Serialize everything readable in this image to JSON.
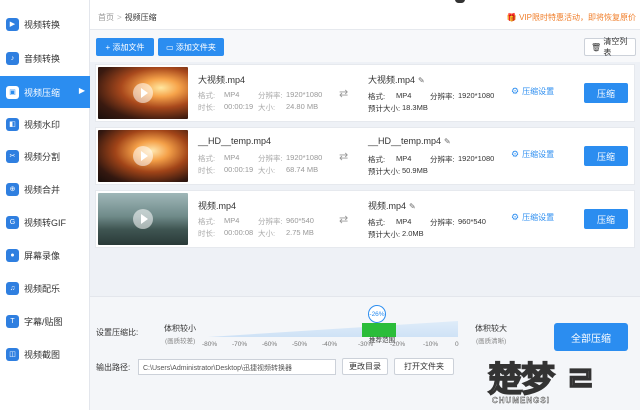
{
  "sidebar": {
    "items": [
      {
        "label": "视频转换",
        "icon": "video-convert-icon"
      },
      {
        "label": "音频转换",
        "icon": "audio-convert-icon"
      },
      {
        "label": "视频压缩",
        "icon": "video-compress-icon",
        "active": true
      },
      {
        "label": "视频水印",
        "icon": "watermark-icon"
      },
      {
        "label": "视频分割",
        "icon": "split-icon"
      },
      {
        "label": "视频合并",
        "icon": "merge-icon"
      },
      {
        "label": "视频转GIF",
        "icon": "gif-icon"
      },
      {
        "label": "屏幕录像",
        "icon": "screen-record-icon"
      },
      {
        "label": "视频配乐",
        "icon": "music-icon"
      },
      {
        "label": "字幕/贴图",
        "icon": "subtitle-icon"
      },
      {
        "label": "视频截图",
        "icon": "screenshot-icon"
      }
    ]
  },
  "topbar": {
    "breadcrumb_home": "首页",
    "breadcrumb_sep": ">",
    "breadcrumb_current": "视频压缩",
    "promo": "VIP限时特惠活动，即将恢复原价"
  },
  "toolbar": {
    "add_file": "添加文件",
    "add_folder": "添加文件夹",
    "clear_list": "清空列表"
  },
  "files": [
    {
      "name": "大视频.mp4",
      "format_label": "格式:",
      "format": "MP4",
      "res_label": "分辨率:",
      "resolution": "1920*1080",
      "duration_label": "时长:",
      "duration": "00:00:19",
      "size_label": "大小:",
      "size": "24.80 MB",
      "out_name": "大视频.mp4",
      "out_format": "MP4",
      "out_resolution": "1920*1080",
      "est_label": "预计大小:",
      "est_size": "18.3MB",
      "settings": "压缩设置",
      "action": "压缩",
      "thumb": "fire"
    },
    {
      "name": "__HD__temp.mp4",
      "format_label": "格式:",
      "format": "MP4",
      "res_label": "分辨率:",
      "resolution": "1920*1080",
      "duration_label": "时长:",
      "duration": "00:00:19",
      "size_label": "大小:",
      "size": "68.74 MB",
      "out_name": "__HD__temp.mp4",
      "out_format": "MP4",
      "out_resolution": "1920*1080",
      "est_label": "预计大小:",
      "est_size": "50.9MB",
      "settings": "压缩设置",
      "action": "压缩",
      "thumb": "fire2"
    },
    {
      "name": "视频.mp4",
      "format_label": "格式:",
      "format": "MP4",
      "res_label": "分辨率:",
      "resolution": "960*540",
      "duration_label": "时长:",
      "duration": "00:00:08",
      "size_label": "大小:",
      "size": "2.75 MB",
      "out_name": "视频.mp4",
      "out_format": "MP4",
      "out_resolution": "960*540",
      "est_label": "预计大小:",
      "est_size": "2.0MB",
      "settings": "压缩设置",
      "action": "压缩",
      "thumb": "sea"
    }
  ],
  "bottom": {
    "ratio_label": "设置压缩比:",
    "left_label": "体积较小",
    "left_sub": "(画质较差)",
    "right_label": "体积较大",
    "right_sub": "(画质清晰)",
    "knob_value": "-26%",
    "recommend": "推荐范围",
    "ticks": [
      "-80%",
      "-70%",
      "-60%",
      "-50%",
      "-40%",
      "-30%",
      "-20%",
      "-10%",
      "0"
    ],
    "output_label": "输出路径:",
    "output_path": "C:\\Users\\Administrator\\Desktop\\迅捷视频转换器",
    "change_dir": "更改目录",
    "open_folder": "打开文件夹",
    "compress_all": "全部压缩"
  },
  "watermark": {
    "big": "楚梦 ㄹ",
    "small": "CHUMENGSI"
  },
  "colors": {
    "accent": "#2b8df0",
    "promo": "#f07e2a",
    "green": "#2bbd3a"
  }
}
